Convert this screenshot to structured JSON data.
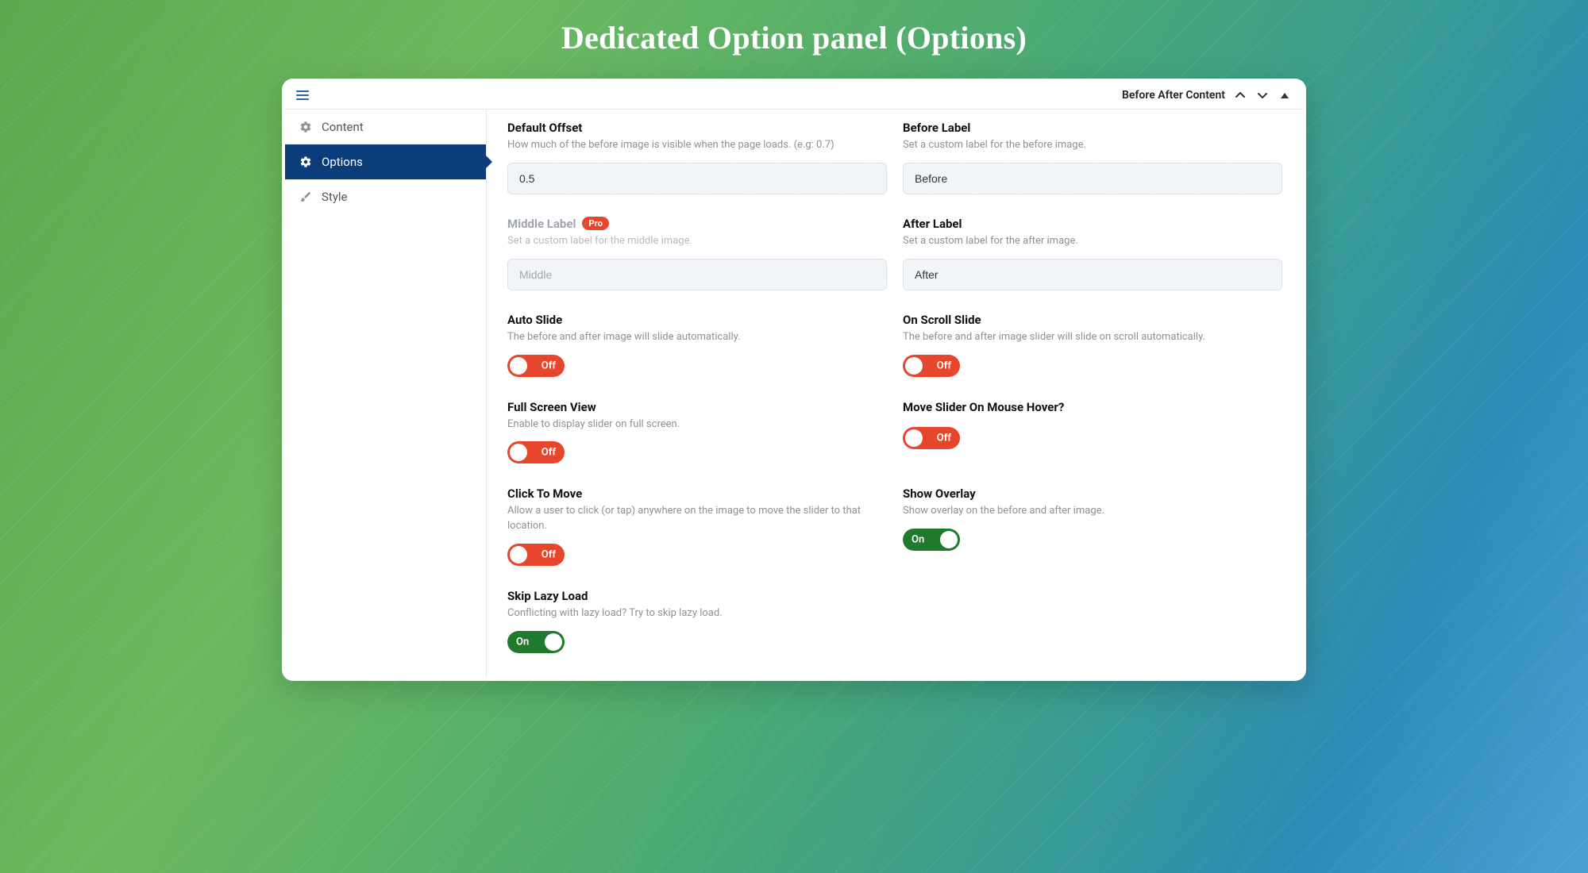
{
  "hero_title": "Dedicated Option panel (Options)",
  "topbar": {
    "breadcrumb": "Before After Content"
  },
  "sidebar": {
    "items": [
      {
        "label": "Content"
      },
      {
        "label": "Options"
      },
      {
        "label": "Style"
      }
    ]
  },
  "toggle_labels": {
    "on": "On",
    "off": "Off"
  },
  "pro_badge": "Pro",
  "fields": {
    "default_offset": {
      "label": "Default Offset",
      "desc": "How much of the before image is visible when the page loads. (e.g: 0.7)",
      "value": "0.5"
    },
    "before_label": {
      "label": "Before Label",
      "desc": "Set a custom label for the before image.",
      "value": "Before"
    },
    "middle_label": {
      "label": "Middle Label",
      "desc": "Set a custom label for the middle image.",
      "value": "Middle"
    },
    "after_label": {
      "label": "After Label",
      "desc": "Set a custom label for the after image.",
      "value": "After"
    },
    "auto_slide": {
      "label": "Auto Slide",
      "desc": "The before and after image will slide automatically.",
      "state": "off"
    },
    "on_scroll_slide": {
      "label": "On Scroll Slide",
      "desc": "The before and after image slider will slide on scroll automatically.",
      "state": "off"
    },
    "full_screen": {
      "label": "Full Screen View",
      "desc": "Enable to display slider on full screen.",
      "state": "off"
    },
    "move_on_hover": {
      "label": "Move Slider On Mouse Hover?",
      "state": "off"
    },
    "click_to_move": {
      "label": "Click To Move",
      "desc": "Allow a user to click (or tap) anywhere on the image to move the slider to that location.",
      "state": "off"
    },
    "show_overlay": {
      "label": "Show Overlay",
      "desc": "Show overlay on the before and after image.",
      "state": "on"
    },
    "skip_lazy": {
      "label": "Skip Lazy Load",
      "desc": "Conflicting with lazy load? Try to skip lazy load.",
      "state": "on"
    }
  }
}
